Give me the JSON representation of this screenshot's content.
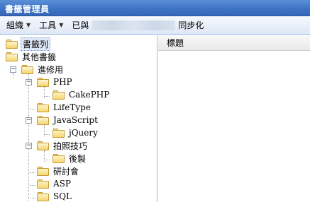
{
  "window": {
    "title": "書籤管理員"
  },
  "toolbar": {
    "organize_label": "組織",
    "tools_label": "工具",
    "sync_prefix": "已與",
    "sync_suffix": "同步化"
  },
  "tree": {
    "root": "書籤列",
    "other": "其他書籤",
    "advanced": "進修用",
    "php": "PHP",
    "cakephp": "CakePHP",
    "lifetype": "LifeType",
    "javascript": "JavaScript",
    "jquery": "jQuery",
    "photo": "拍照技巧",
    "postprocess": "後製",
    "seminar": "研討會",
    "asp": "ASP",
    "sql": "SQL"
  },
  "grid": {
    "col_title": "標題"
  }
}
